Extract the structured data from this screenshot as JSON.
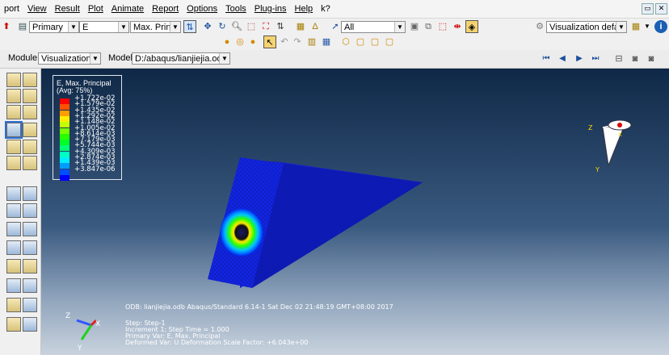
{
  "menu": [
    "port",
    "View",
    "Result",
    "Plot",
    "Animate",
    "Report",
    "Options",
    "Tools",
    "Plug-ins",
    "Help",
    "k?"
  ],
  "toolbar": {
    "primary": "Primary",
    "variable": "E",
    "invariant": "Max. Principal",
    "selection": "All",
    "visualization_defaults": "Visualization defaults"
  },
  "context": {
    "module_label": "Module:",
    "module_value": "Visualization",
    "model_label": "Model:",
    "model_value": "D:/abaqus/lianjiejia.odb"
  },
  "legend": {
    "title": [
      "E, Max. Principal",
      "(Avg: 75%)"
    ],
    "values": [
      "+1.722e-02",
      "+1.579e-02",
      "+1.435e-02",
      "+1.292e-02",
      "+1.148e-02",
      "+1.005e-02",
      "+8.614e-03",
      "+7.179e-03",
      "+5.744e-03",
      "+4.309e-03",
      "+2.874e-03",
      "+1.439e-03",
      "+3.847e-06"
    ],
    "colors": [
      "#ff0000",
      "#ff4f00",
      "#ff9d00",
      "#ffec00",
      "#c3ff00",
      "#75ff00",
      "#27ff00",
      "#00ff27",
      "#00ff75",
      "#00ffc3",
      "#00ecff",
      "#009dff",
      "#004fff",
      "#0000ff"
    ]
  },
  "info": {
    "odb_line": "ODB: lianjiejia.odb     Abaqus/Standard 6.14-1     Sat Dec 02 21:48:19 GMT+08:00 2017",
    "step": "Step: Step-1",
    "increment": "Increment    1: Step Time =     1.000",
    "primary_var": "Primary Var: E, Max. Principal",
    "deformed_var": "Deformed Var: U   Deformation Scale Factor: +6.043e+00"
  },
  "triad_labels": {
    "x": "X",
    "y": "Y",
    "z": "Z"
  }
}
